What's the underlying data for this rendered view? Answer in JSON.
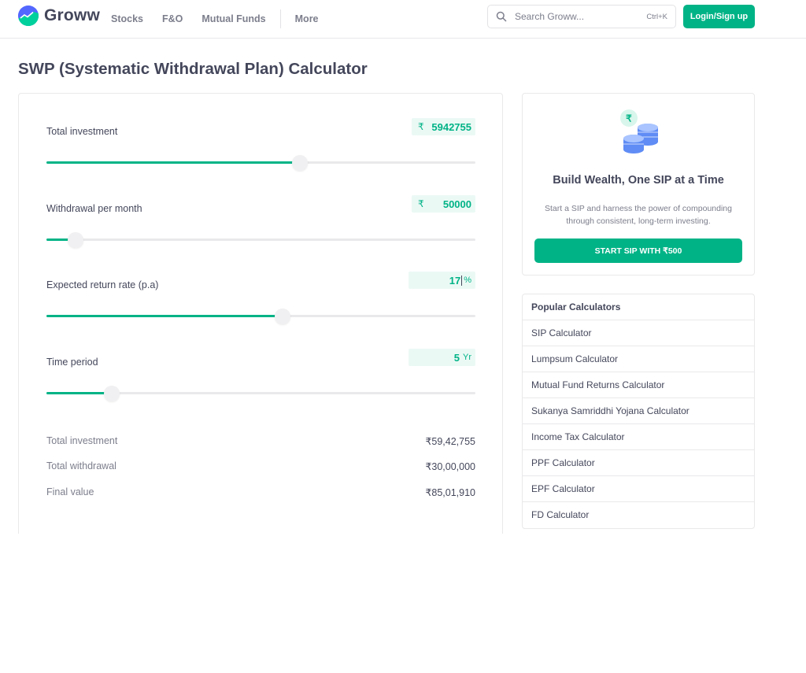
{
  "brand": {
    "name": "Groww",
    "accent": "#00b386",
    "text": "#44475b"
  },
  "nav": {
    "items": [
      "Stocks",
      "F&O",
      "Mutual Funds"
    ],
    "more": "More"
  },
  "search": {
    "placeholder": "Search Groww...",
    "shortcut": "Ctrl+K"
  },
  "header": {
    "login_label": "Login/Sign up"
  },
  "page": {
    "title": "SWP (Systematic Withdrawal Plan) Calculator"
  },
  "calculator": {
    "fields": [
      {
        "label": "Total investment",
        "prefix": "₹",
        "value": "5942755",
        "suffix": "",
        "slider_fraction": 0.59
      },
      {
        "label": "Withdrawal per month",
        "prefix": "₹",
        "value": "50000",
        "suffix": "",
        "slider_fraction": 0.067
      },
      {
        "label": "Expected return rate (p.a)",
        "prefix": "",
        "value": "17",
        "suffix": "%",
        "slider_fraction": 0.55
      },
      {
        "label": "Time period",
        "prefix": "",
        "value": "5",
        "suffix": "Yr",
        "slider_fraction": 0.153
      }
    ],
    "summary": [
      {
        "label": "Total investment",
        "value": "₹59,42,755"
      },
      {
        "label": "Total withdrawal",
        "value": "₹30,00,000"
      },
      {
        "label": "Final value",
        "value": "₹85,01,910"
      }
    ]
  },
  "promo": {
    "icon": "rupee-coins-icon",
    "coin_symbol": "₹",
    "title": "Build Wealth, One SIP at a Time",
    "description": "Start a SIP and harness the power of compounding through consistent, long-term investing.",
    "button_label": "START SIP WITH ₹500"
  },
  "popular": {
    "title": "Popular Calculators",
    "items": [
      "SIP Calculator",
      "Lumpsum Calculator",
      "Mutual Fund Returns Calculator",
      "Sukanya Samriddhi Yojana Calculator",
      "Income Tax Calculator",
      "PPF Calculator",
      "EPF Calculator",
      "FD Calculator"
    ]
  }
}
